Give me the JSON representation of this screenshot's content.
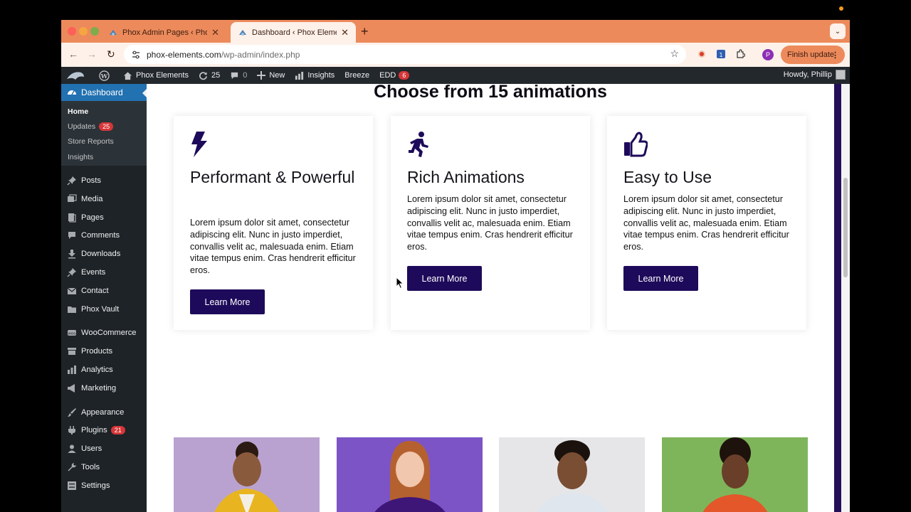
{
  "browser": {
    "tabs": [
      {
        "title": "Phox Admin Pages ‹ Phox Ele",
        "active": false
      },
      {
        "title": "Dashboard ‹ Phox Elements –",
        "active": true
      }
    ],
    "url_host": "phox-elements.com",
    "url_path": "/wp-admin/index.php",
    "profile_initial": "P",
    "finish_update_label": "Finish update",
    "extension_badge": "1"
  },
  "adminbar": {
    "site_name": "Phox Elements",
    "updates_count": "25",
    "comments_count": "0",
    "new_label": "New",
    "insights_label": "Insights",
    "breeze_label": "Breeze",
    "edd_label": "EDD",
    "edd_count": "6",
    "howdy": "Howdy, Phillip"
  },
  "sidebar": {
    "dashboard": "Dashboard",
    "sub": {
      "home": "Home",
      "updates": "Updates",
      "updates_count": "25",
      "store_reports": "Store Reports",
      "insights": "Insights"
    },
    "group1": [
      "Posts",
      "Media",
      "Pages",
      "Comments",
      "Downloads",
      "Events",
      "Contact",
      "Phox Vault"
    ],
    "group2": [
      "WooCommerce",
      "Products",
      "Analytics",
      "Marketing"
    ],
    "group3": {
      "appearance": "Appearance",
      "plugins": "Plugins",
      "plugins_count": "21",
      "users": "Users",
      "tools": "Tools",
      "settings": "Settings"
    }
  },
  "content": {
    "headline": "Choose from 15 animations",
    "cards": [
      {
        "title": "Performant & Powerful",
        "body": "Lorem ipsum dolor sit amet, consectetur adipiscing elit. Nunc in justo imperdiet, convallis velit ac, malesuada enim. Etiam vitae tempus enim. Cras hendrerit efficitur eros.",
        "button": "Learn More",
        "icon": "lightning-bolt-icon"
      },
      {
        "title": "Rich Animations",
        "body": "Lorem ipsum dolor sit amet, consectetur adipiscing elit. Nunc in justo imperdiet, convallis velit ac, malesuada enim. Etiam vitae tempus enim. Cras hendrerit efficitur eros.",
        "button": "Learn More",
        "icon": "running-person-icon"
      },
      {
        "title": "Easy to Use",
        "body": "Lorem ipsum dolor sit amet, consectetur adipiscing elit. Nunc in justo imperdiet, convallis velit ac, malesuada enim. Etiam vitae tempus enim. Cras hendrerit efficitur eros.",
        "button": "Learn More",
        "icon": "thumbs-up-icon"
      }
    ]
  },
  "colors": {
    "accent": "#1e0a5a",
    "tab_strip": "#ec8a5b",
    "wp_admin_bar": "#23282d",
    "wp_menu_active": "#2271b1"
  }
}
